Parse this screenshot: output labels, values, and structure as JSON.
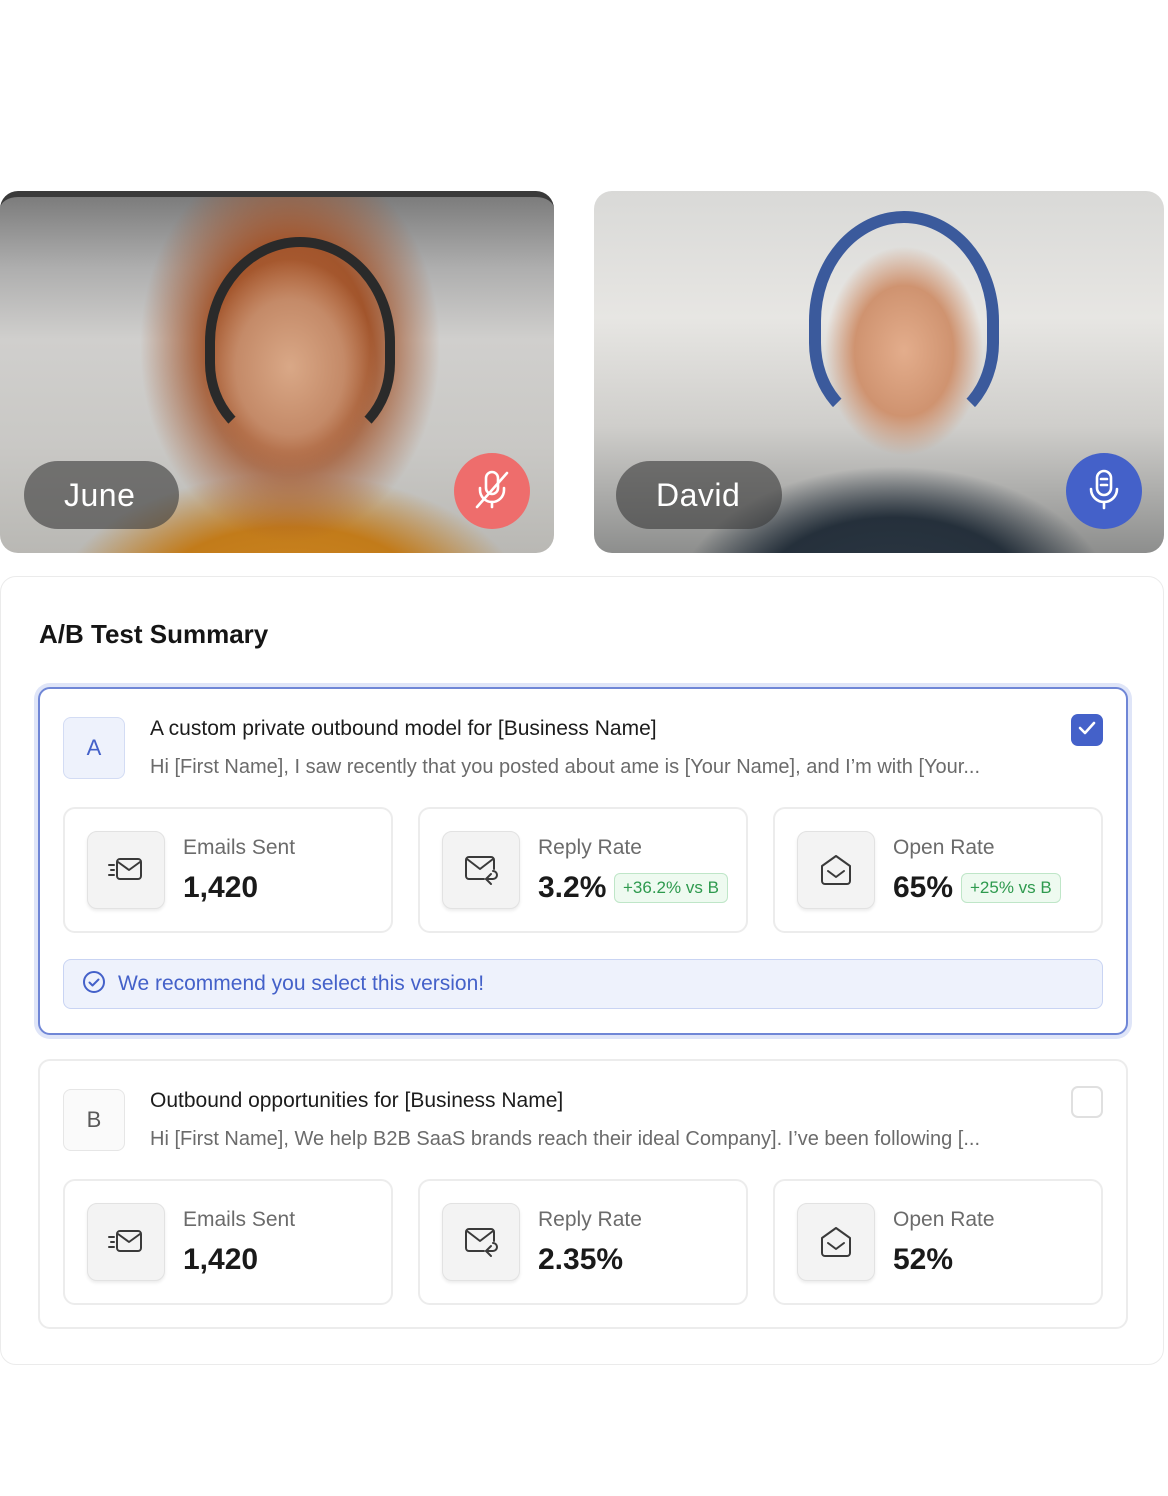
{
  "call": {
    "participants": [
      {
        "name": "June",
        "mic": "muted",
        "mic_icon": "mic-off-icon",
        "mic_color": "#ee6d6c"
      },
      {
        "name": "David",
        "mic": "on",
        "mic_icon": "mic-icon",
        "mic_color": "#4461c9"
      }
    ]
  },
  "summary": {
    "title": "A/B Test Summary",
    "variants": [
      {
        "letter": "A",
        "selected": true,
        "heading": "A custom private outbound model for [Business Name]",
        "preview": "Hi [First Name], I saw recently that you posted about ame is [Your Name], and I’m with [Your...",
        "stats": {
          "emails_sent": {
            "label": "Emails Sent",
            "value": "1,420",
            "icon": "send-mail-icon"
          },
          "reply_rate": {
            "label": "Reply Rate",
            "value": "3.2%",
            "delta": "+36.2% vs B",
            "icon": "mail-reply-icon"
          },
          "open_rate": {
            "label": "Open Rate",
            "value": "65%",
            "delta": "+25% vs B",
            "icon": "open-mail-icon"
          }
        },
        "recommendation": "We recommend you select this version!"
      },
      {
        "letter": "B",
        "selected": false,
        "heading": "Outbound opportunities for [Business Name]",
        "preview": "Hi [First Name], We help B2B SaaS brands reach their ideal Company]. I’ve been following [...",
        "stats": {
          "emails_sent": {
            "label": "Emails Sent",
            "value": "1,420",
            "icon": "send-mail-icon"
          },
          "reply_rate": {
            "label": "Reply Rate",
            "value": "2.35%",
            "icon": "mail-reply-icon"
          },
          "open_rate": {
            "label": "Open Rate",
            "value": "52%",
            "icon": "open-mail-icon"
          }
        }
      }
    ]
  },
  "colors": {
    "accent": "#4461c9",
    "accent_light": "#eef2fc",
    "positive": "#2e9a4e",
    "muted_mic": "#ee6d6c"
  }
}
